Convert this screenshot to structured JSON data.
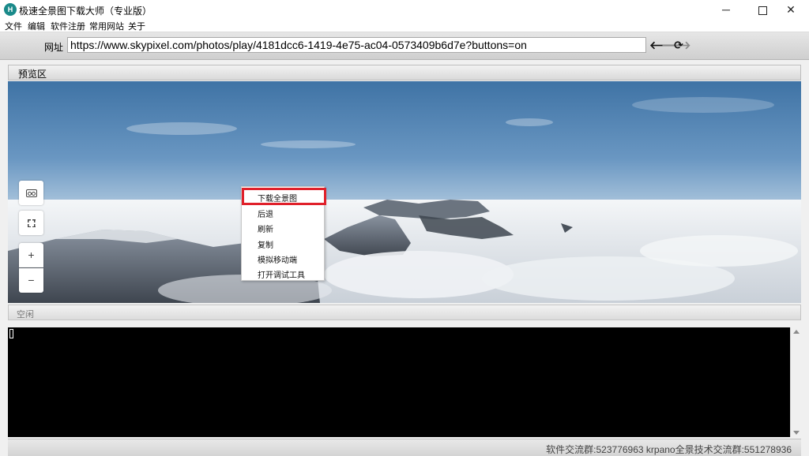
{
  "window": {
    "title": "极速全景图下载大师（专业版）",
    "icon_letter": "H",
    "minimize": "─",
    "close": "✕"
  },
  "menu": {
    "items": [
      "文件",
      "编辑",
      "软件注册",
      "常用网站",
      "关于"
    ]
  },
  "urlbar": {
    "label": "网址",
    "value": "https://www.skypixel.com/photos/play/4181dcc6-1419-4e75-ac04-0573409b6d7e?buttons=on",
    "back_glyph": "🡐",
    "forward_glyph": "🡒",
    "refresh_glyph": "⟳"
  },
  "preview": {
    "title": "预览区",
    "zoom_in": "+",
    "zoom_out": "−"
  },
  "context_menu": {
    "items": [
      "下载全景图",
      "后退",
      "刷新",
      "复制",
      "模拟移动端",
      "打开调试工具"
    ]
  },
  "status": {
    "text": "空闲"
  },
  "footer": {
    "text": "软件交流群:523776963 krpano全景技术交流群:551278936"
  },
  "colors": {
    "highlight": "#e0202a",
    "app_icon": "#1a8a8a"
  },
  "icons": {
    "vr": "vr-goggles-icon",
    "fullscreen": "fullscreen-icon",
    "back": "arrow-left-icon",
    "forward": "arrow-right-icon",
    "refresh": "refresh-icon"
  }
}
